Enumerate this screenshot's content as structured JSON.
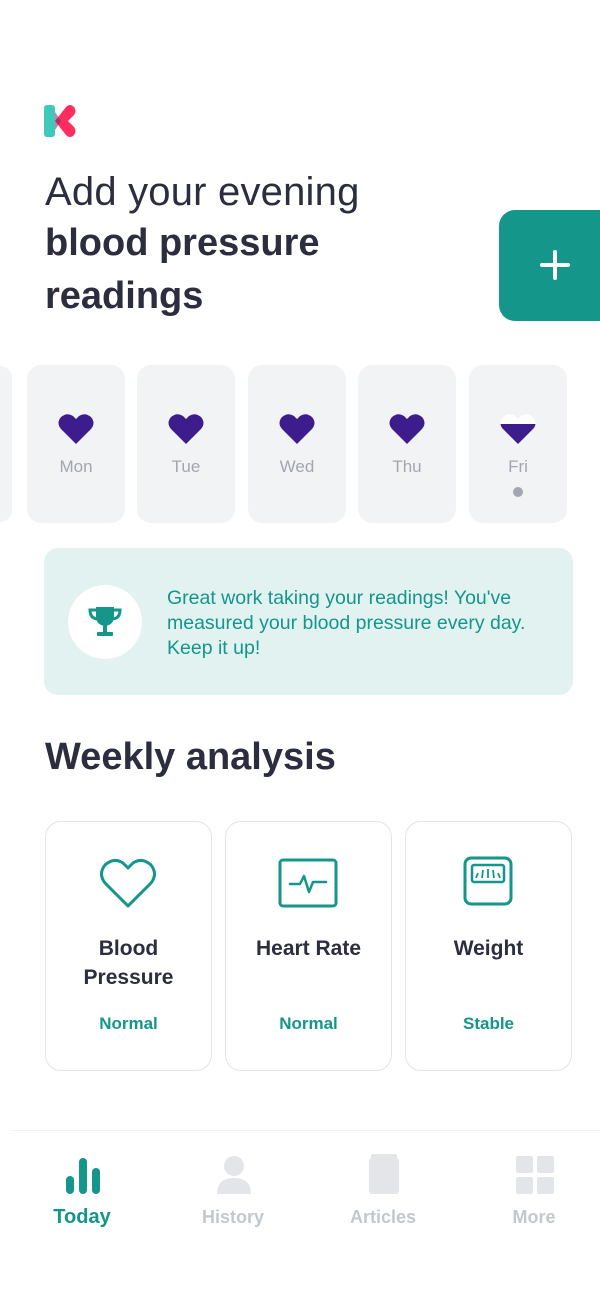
{
  "header": {
    "headline_line1": "Add your evening",
    "headline_line2": "blood pressure",
    "headline_line3": "readings",
    "add_icon": "plus-icon"
  },
  "days": [
    {
      "label": "Mon",
      "state": "complete"
    },
    {
      "label": "Tue",
      "state": "complete"
    },
    {
      "label": "Wed",
      "state": "complete"
    },
    {
      "label": "Thu",
      "state": "complete"
    },
    {
      "label": "Fri",
      "state": "half",
      "today": true
    }
  ],
  "streak": {
    "icon": "trophy-icon",
    "message": "Great work taking your readings! You've measured your blood pressure every day. Keep it up!"
  },
  "weekly_analysis": {
    "title": "Weekly analysis",
    "cards": [
      {
        "name_line1": "Blood",
        "name_line2": "Pressure",
        "status": "Normal",
        "icon": "heart-outline-icon"
      },
      {
        "name_line1": "Heart Rate",
        "name_line2": "",
        "status": "Normal",
        "icon": "heart-rate-monitor-icon"
      },
      {
        "name_line1": "Weight",
        "name_line2": "",
        "status": "Stable",
        "icon": "scale-icon"
      }
    ]
  },
  "tabs": [
    {
      "label": "Today",
      "icon": "bar-chart-icon",
      "active": true
    },
    {
      "label": "History",
      "icon": "person-icon",
      "active": false
    },
    {
      "label": "Articles",
      "icon": "book-icon",
      "active": false
    },
    {
      "label": "More",
      "icon": "grid-icon",
      "active": false
    }
  ],
  "colors": {
    "primary": "#14968a",
    "heart": "#3d1d8e",
    "card_bg": "#f1f3f5",
    "banner_bg": "#e2f2f1",
    "text_dark": "#2d2d40",
    "inactive": "#c4c7cd",
    "logo_teal": "#3ec9bb",
    "logo_red": "#ff2e5f"
  }
}
